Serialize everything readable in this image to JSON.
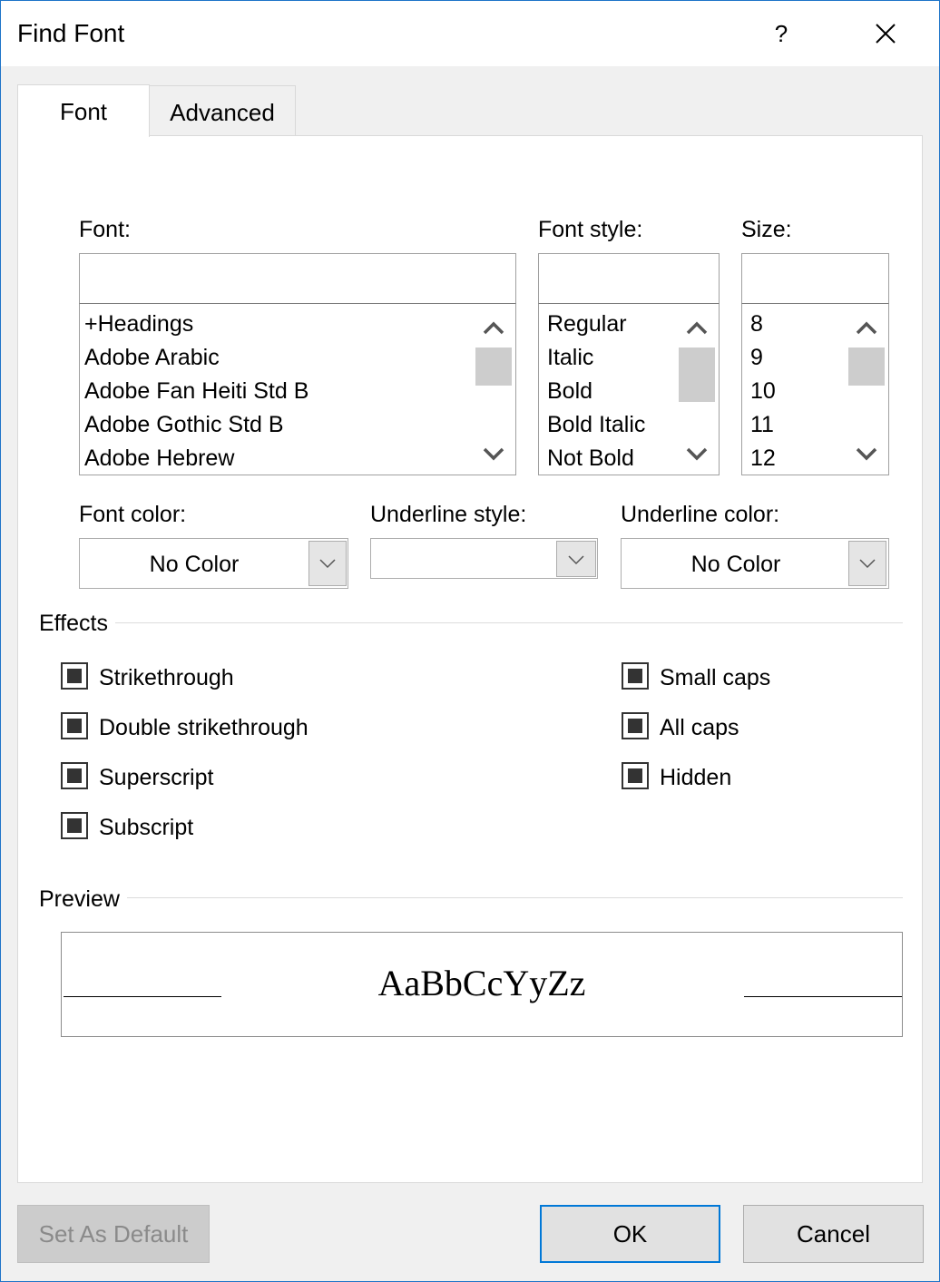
{
  "window": {
    "title": "Find Font",
    "help_label": "?"
  },
  "tabs": [
    {
      "label": "Font",
      "selected": true
    },
    {
      "label": "Advanced",
      "selected": false
    }
  ],
  "font": {
    "label": "Font:",
    "value": "",
    "items": [
      "+Headings",
      "Adobe Arabic",
      "Adobe Fan Heiti Std B",
      "Adobe Gothic Std B",
      "Adobe Hebrew"
    ]
  },
  "font_style": {
    "label": "Font style:",
    "value": "",
    "items": [
      "Regular",
      "Italic",
      "Bold",
      "Bold Italic",
      "Not Bold"
    ]
  },
  "size": {
    "label": "Size:",
    "value": "",
    "items": [
      "8",
      "9",
      "10",
      "11",
      "12"
    ]
  },
  "font_color": {
    "label": "Font color:",
    "value": "No Color"
  },
  "underline_style": {
    "label": "Underline style:",
    "value": ""
  },
  "underline_color": {
    "label": "Underline color:",
    "value": "No Color"
  },
  "effects": {
    "title": "Effects",
    "left": [
      {
        "label": "Strikethrough",
        "state": "indeterminate"
      },
      {
        "label": "Double strikethrough",
        "state": "indeterminate"
      },
      {
        "label": "Superscript",
        "state": "indeterminate"
      },
      {
        "label": "Subscript",
        "state": "indeterminate"
      }
    ],
    "right": [
      {
        "label": "Small caps",
        "state": "indeterminate"
      },
      {
        "label": "All caps",
        "state": "indeterminate"
      },
      {
        "label": "Hidden",
        "state": "indeterminate"
      }
    ]
  },
  "preview": {
    "title": "Preview",
    "sample": "AaBbCcYyZz"
  },
  "buttons": {
    "set_default": "Set As Default",
    "ok": "OK",
    "cancel": "Cancel"
  },
  "colors": {
    "accent": "#0078d7",
    "window_border": "#1e74c8",
    "thumb": "#cdcdcd"
  },
  "icons": {
    "close": "close-icon",
    "scroll_up": "chevron-up-icon",
    "scroll_down": "chevron-down-icon",
    "dropdown": "chevron-down-icon"
  }
}
